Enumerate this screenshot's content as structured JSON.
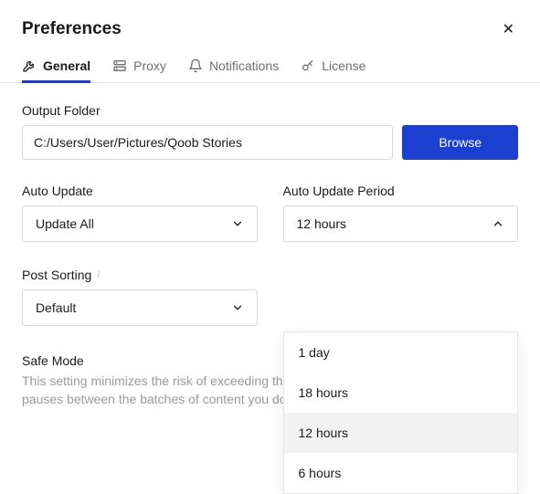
{
  "title": "Preferences",
  "tabs": {
    "general": "General",
    "proxy": "Proxy",
    "notifications": "Notifications",
    "license": "License"
  },
  "outputFolder": {
    "label": "Output Folder",
    "value": "C:/Users/User/Pictures/Qoob Stories",
    "browse": "Browse"
  },
  "autoUpdate": {
    "label": "Auto Update",
    "value": "Update All"
  },
  "autoUpdatePeriod": {
    "label": "Auto Update Period",
    "value": "12 hours",
    "options": [
      "1 day",
      "18 hours",
      "12 hours",
      "6 hours"
    ]
  },
  "postSorting": {
    "label": "Post Sorting",
    "value": "Default"
  },
  "safeMode": {
    "title": "Safe Mode",
    "desc": "This setting minimizes the risk of exceeding the service download limits by adding pauses between the batches of content you download."
  }
}
